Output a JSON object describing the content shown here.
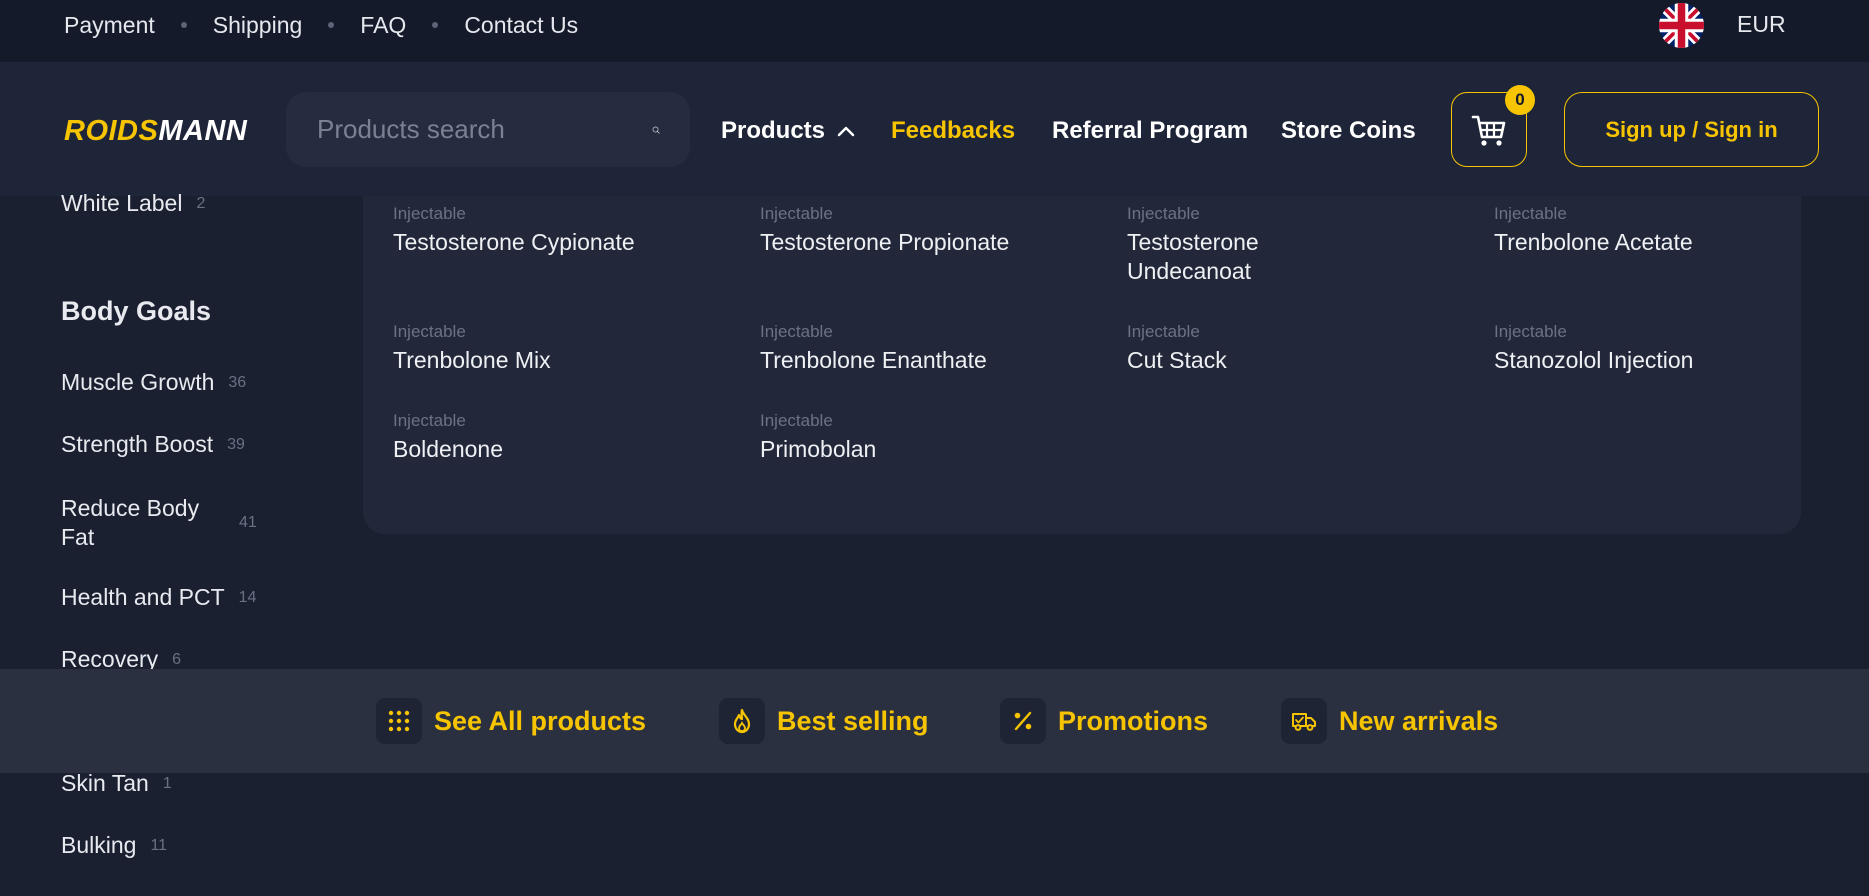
{
  "topbar": {
    "links": [
      "Payment",
      "Shipping",
      "FAQ",
      "Contact Us"
    ],
    "currency": "EUR"
  },
  "header": {
    "logo_part1": "ROIDS",
    "logo_part2": "MANN",
    "search_placeholder": "Products search",
    "nav": {
      "products": "Products",
      "feedbacks": "Feedbacks",
      "referral": "Referral Program",
      "store_coins": "Store Coins"
    },
    "cart_count": "0",
    "signin_label": "Sign up / Sign in"
  },
  "sidebar": {
    "white_label": {
      "label": "White Label",
      "count": "2"
    },
    "body_goals_heading": "Body Goals",
    "items": [
      {
        "label": "Muscle Growth",
        "count": "36"
      },
      {
        "label": "Strength Boost",
        "count": "39"
      },
      {
        "label": "Reduce Body Fat",
        "count": "41"
      },
      {
        "label": "Health and PCT",
        "count": "14"
      },
      {
        "label": "Recovery",
        "count": "6"
      },
      {
        "label": "Skin Tan",
        "count": "1"
      },
      {
        "label": "Bulking",
        "count": "11"
      }
    ]
  },
  "products": [
    {
      "category": "Injectable",
      "name": "Testosterone Cypionate"
    },
    {
      "category": "Injectable",
      "name": "Testosterone Propionate"
    },
    {
      "category": "Injectable",
      "name": "Testosterone Undecanoat"
    },
    {
      "category": "Injectable",
      "name": "Trenbolone Acetate"
    },
    {
      "category": "Injectable",
      "name": "Trenbolone Mix"
    },
    {
      "category": "Injectable",
      "name": "Trenbolone Enanthate"
    },
    {
      "category": "Injectable",
      "name": "Cut Stack"
    },
    {
      "category": "Injectable",
      "name": "Stanozolol Injection"
    },
    {
      "category": "Injectable",
      "name": "Boldenone"
    },
    {
      "category": "Injectable",
      "name": "Primobolan"
    }
  ],
  "bottombar": {
    "see_all": "See All products",
    "best_selling": "Best selling",
    "promotions": "Promotions",
    "new_arrivals": "New arrivals"
  },
  "colors": {
    "accent": "#f6c400",
    "background": "#1b2030",
    "topbar": "#141a2a"
  }
}
